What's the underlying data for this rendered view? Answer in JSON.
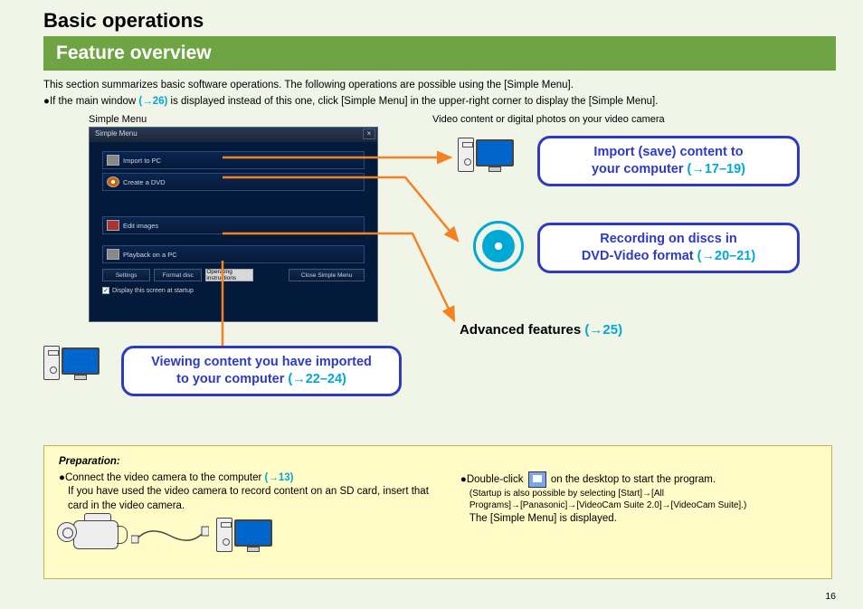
{
  "headings": {
    "main": "Basic operations",
    "sub": "Feature overview"
  },
  "intro": "This section summarizes basic software operations. The following operations are possible using the [Simple Menu].",
  "note_prefix": "If the main window ",
  "note_ref": "(→26)",
  "note_suffix": " is displayed instead of this one, click [Simple Menu] in the upper-right corner to display the [Simple Menu].",
  "sm_label": "Simple Menu",
  "sm": {
    "title": "Simple Menu",
    "items": [
      "Import to PC",
      "Create a DVD",
      "Edit images",
      "Playback on a PC"
    ],
    "buttons": [
      "Settings",
      "Format disc",
      "Operating instructions",
      "Close Simple Menu"
    ],
    "checkbox": "Display this screen at startup"
  },
  "right_caption": "Video content or digital photos on your video camera",
  "callouts": {
    "import": {
      "l1": "Import (save) content to",
      "l2": "your computer ",
      "ref": "(→17–19)"
    },
    "dvd": {
      "l1": "Recording on discs in",
      "l2": "DVD-Video format ",
      "ref": "(→20–21)"
    },
    "view": {
      "l1": "Viewing content you have imported",
      "l2": "to your computer ",
      "ref": "(→22–24)"
    }
  },
  "advanced": {
    "label": "Advanced features ",
    "ref": "(→25)"
  },
  "prep": {
    "title": "Preparation:",
    "left_b1": "Connect the video camera to the computer ",
    "left_ref": "(→13)",
    "left_b2": "If you have used the video camera to record content on an SD card, insert that card in the video camera.",
    "right_b1a": "Double-click ",
    "right_b1b": " on the desktop to start the program.",
    "right_note": "(Startup is also possible by selecting [Start]→[All Programs]→[Panasonic]→[VideoCam Suite 2.0]→[VideoCam Suite].)",
    "right_b2": "The [Simple Menu] is displayed."
  },
  "page_number": "16"
}
